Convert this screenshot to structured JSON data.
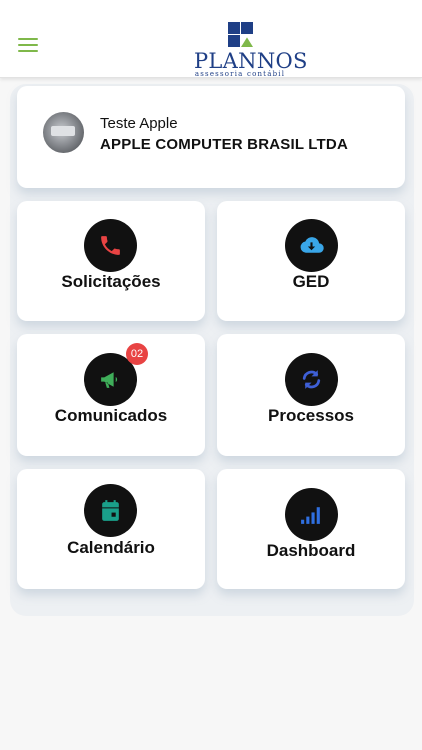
{
  "header": {
    "menu_icon": "hamburger-icon",
    "logo": {
      "name": "PLANNOS",
      "tagline": "assessoria contábil",
      "brand_blue": "#1f3f86",
      "brand_green": "#7fb84a"
    }
  },
  "profile": {
    "name": "Teste Apple",
    "company": "APPLE COMPUTER BRASIL LTDA"
  },
  "tiles": [
    {
      "label": "Solicitações",
      "icon": "phone-icon",
      "icon_color": "#e84343"
    },
    {
      "label": "GED",
      "icon": "cloud-download-icon",
      "icon_color": "#39a6e8"
    },
    {
      "label": "Comunicados",
      "icon": "megaphone-icon",
      "icon_color": "#3fae5a",
      "badge": "02"
    },
    {
      "label": "Processos",
      "icon": "refresh-icon",
      "icon_color": "#3e5fd6"
    },
    {
      "label": "Calendário",
      "icon": "calendar-icon",
      "icon_color": "#1aa08a"
    },
    {
      "label": "Dashboard",
      "icon": "signal-bars-icon",
      "icon_color": "#2f6fe0"
    }
  ]
}
